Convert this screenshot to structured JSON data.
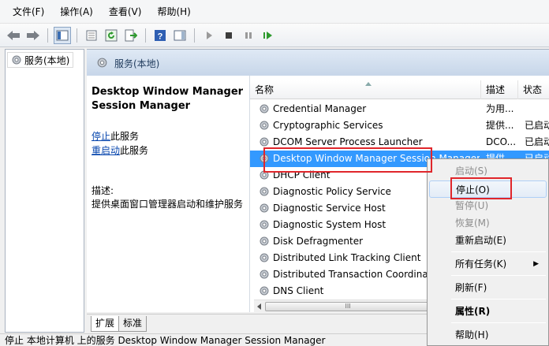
{
  "menu": [
    "文件(F)",
    "操作(A)",
    "查看(V)",
    "帮助(H)"
  ],
  "toolbar_icons": [
    "back-icon",
    "forward-icon",
    "show-console-tree-icon",
    "properties-icon",
    "refresh-icon",
    "export-list-icon",
    "help-icon",
    "action-pane-icon",
    "start-service-icon",
    "stop-service-icon",
    "pause-service-icon",
    "restart-service-icon"
  ],
  "tree": {
    "item_label": "服务(本地)"
  },
  "header": {
    "title": "服务(本地)"
  },
  "description": {
    "service_title": "Desktop Window Manager Session Manager",
    "stop_link": "停止",
    "stop_suffix": "此服务",
    "restart_link": "重启动",
    "restart_suffix": "此服务",
    "desc_label": "描述:",
    "desc_text": "提供桌面窗口管理器启动和维护服务"
  },
  "columns": {
    "name": "名称",
    "description": "描述",
    "status": "状态"
  },
  "services": [
    {
      "name": "Credential Manager",
      "description": "为用...",
      "status": ""
    },
    {
      "name": "Cryptographic Services",
      "description": "提供...",
      "status": "已启动"
    },
    {
      "name": "DCOM Server Process Launcher",
      "description": "DCO...",
      "status": "已启动"
    },
    {
      "name": "Desktop Window Manager Session Manager",
      "description": "提供...",
      "status": "已启动"
    },
    {
      "name": "DHCP Client",
      "description": "",
      "status": ""
    },
    {
      "name": "Diagnostic Policy Service",
      "description": "",
      "status": ""
    },
    {
      "name": "Diagnostic Service Host",
      "description": "",
      "status": ""
    },
    {
      "name": "Diagnostic System Host",
      "description": "",
      "status": ""
    },
    {
      "name": "Disk Defragmenter",
      "description": "",
      "status": ""
    },
    {
      "name": "Distributed Link Tracking Client",
      "description": "",
      "status": ""
    },
    {
      "name": "Distributed Transaction Coordinator",
      "description": "",
      "status": ""
    },
    {
      "name": "DNS Client",
      "description": "",
      "status": ""
    }
  ],
  "scroll_thumb_glyph": "III",
  "tabs": [
    "扩展",
    "标准"
  ],
  "status_bar": "停止 本地计算机 上的服务 Desktop Window Manager Session Manager",
  "context_menu": {
    "start": "启动(S)",
    "stop": "停止(O)",
    "pause": "暂停(U)",
    "resume": "恢复(M)",
    "restart": "重新启动(E)",
    "all_tasks": "所有任务(K)",
    "all_tasks_arrow": "▶",
    "refresh": "刷新(F)",
    "properties": "属性(R)",
    "help": "帮助(H)"
  },
  "colors": {
    "selection": "#3399ff",
    "highlight_box": "#e0262b",
    "link": "#0645ad"
  }
}
